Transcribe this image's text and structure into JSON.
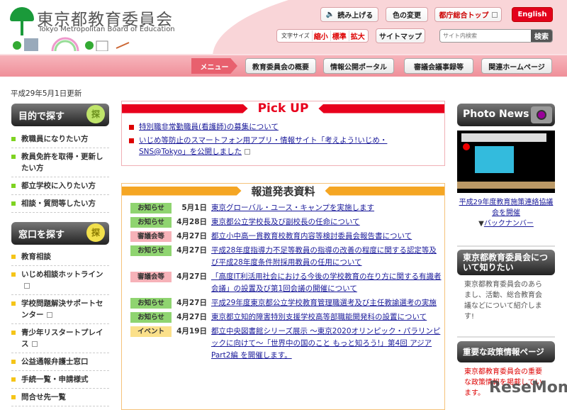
{
  "header": {
    "logo_ja": "東京都教育委員会",
    "logo_en": "Tokyo Metropolitan Board of Education",
    "read_aloud": "読み上げる",
    "color_change": "色の変更",
    "metro_top": "都庁総合トップ",
    "english": "English",
    "font_size_label": "文字サイズ",
    "font_small": "縮小",
    "font_standard": "標準",
    "font_large": "拡大",
    "sitemap": "サイトマップ",
    "search_placeholder": "サイト内検索",
    "search_button": "検索"
  },
  "nav": {
    "menu": "メニュー",
    "items": [
      "教育委員会の概要",
      "情報公開ポータル",
      "審議会議事録等",
      "関連ホームページ"
    ]
  },
  "updated": "平成29年5月1日更新",
  "left": {
    "purpose_title": "目的で探す",
    "purpose_icon": "探",
    "purpose_items": [
      "教職員になりたい方",
      "教員免許を取得・更新したい方",
      "都立学校に入りたい方",
      "相談・質問等したい方"
    ],
    "window_title": "窓口を探す",
    "window_icon": "探",
    "window_items": [
      "教育相談",
      "いじめ相談ホットライン",
      "学校問題解決サポートセンター",
      "青少年リスタートプレイス",
      "公益通報弁護士窓口",
      "手続一覧・申請様式",
      "問合せ先一覧"
    ]
  },
  "pickup": {
    "title": "Pick UP",
    "items": [
      "特別職非常勤職員(看護師)の募集について",
      "いじめ等防止のスマートフォン用アプリ・情報サイト「考えよう!いじめ・SNS@Tokyo」を公開しました"
    ]
  },
  "news": {
    "title": "報道発表資料",
    "rows": [
      {
        "badge": "お知らせ",
        "type": "info",
        "date": "5月1日",
        "title": "東京グローバル・ユース・キャンプを実施します"
      },
      {
        "badge": "お知らせ",
        "type": "info",
        "date": "4月28日",
        "title": "東京都公立学校長及び副校長の任命について"
      },
      {
        "badge": "審議会等",
        "type": "council",
        "date": "4月27日",
        "title": "都立小中高一貫教育校教育内容等検討委員会報告書について"
      },
      {
        "badge": "お知らせ",
        "type": "info",
        "date": "4月27日",
        "title": "平成28年度指導力不足等教員の指導の改善の程度に関する認定等及び平成28年度条件附採用教員の任用について"
      },
      {
        "badge": "審議会等",
        "type": "council",
        "date": "4月27日",
        "title": "「高度IT利活用社会における今後の学校教育の在り方に関する有識者会議」の設置及び第1回会議の開催について"
      },
      {
        "badge": "お知らせ",
        "type": "info",
        "date": "4月27日",
        "title": "平成29年度東京都公立学校教育管理職選考及び主任教諭選考の実施"
      },
      {
        "badge": "お知らせ",
        "type": "info",
        "date": "4月27日",
        "title": "東京都立知的障害特別支援学校高等部職能開発科の設置について"
      },
      {
        "badge": "イベント",
        "type": "event",
        "date": "4月19日",
        "title": "都立中央図書館シリーズ展示 ～東京2020オリンピック・パラリンピックに向けて～「世界中の国のこと もっと知ろう!」第4回 アジアPart2編 を開催します。"
      }
    ]
  },
  "right": {
    "photo_title": "Photo News",
    "photo_caption": "平成29年度教育施策連絡協議会を開催",
    "backnumber": "バックナンバー",
    "about_title": "東京都教育委員会について知りたい",
    "about_text": "東京都教育委員会のあらまし、活動、総合教育会議などについて紹介します!",
    "policy_title": "重要な政策情報ページ",
    "policy_text": "東京都教育委員会の重要な政策情報を掲載しています。"
  },
  "watermark": "ReseMom",
  "colors": {
    "info": "#8fd470",
    "council": "#f6b2b8",
    "event": "#fbe08a",
    "pickup": "#e8001c",
    "news": "#f5a623"
  }
}
